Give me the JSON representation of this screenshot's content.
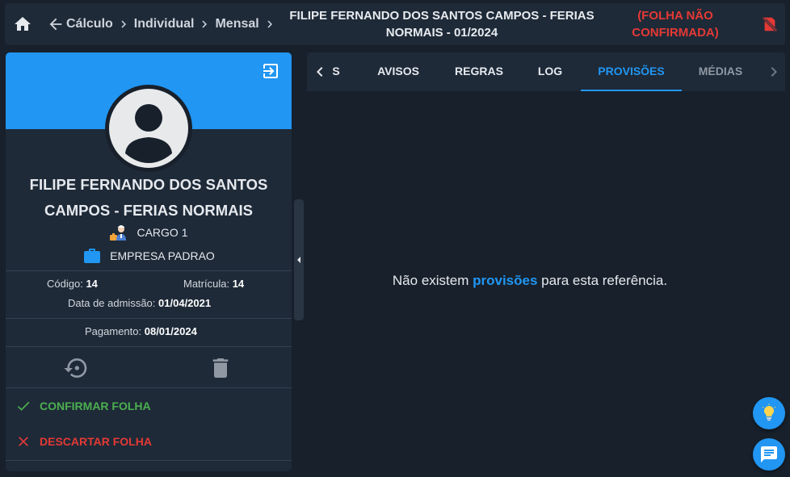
{
  "header": {
    "breadcrumbs": [
      "Cálculo",
      "Individual",
      "Mensal"
    ],
    "title_line1": "FILIPE FERNANDO DOS SANTOS CAMPOS - FERIAS",
    "title_line2": "NORMAIS - 01/2024",
    "status_line1": "(FOLHA NÃO",
    "status_line2": "CONFIRMADA)",
    "status_color": "#e53935"
  },
  "employee": {
    "name_line1": "FILIPE FERNANDO DOS SANTOS",
    "name_line2": "CAMPOS - FERIAS NORMAIS",
    "cargo": "CARGO 1",
    "empresa": "EMPRESA PADRAO",
    "codigo_label": "Código:",
    "codigo": "14",
    "matricula_label": "Matrícula:",
    "matricula": "14",
    "admissao_label": "Data de admissão:",
    "admissao": "01/04/2021",
    "pagamento_label": "Pagamento:",
    "pagamento": "08/01/2024"
  },
  "actions": {
    "confirm_label": "CONFIRMAR FOLHA",
    "confirm_color": "#4caf50",
    "discard_label": "DESCARTAR FOLHA",
    "discard_color": "#e53935"
  },
  "tabs": {
    "items": [
      "S",
      "AVISOS",
      "REGRAS",
      "LOG",
      "PROVISÕES",
      "MÉDIAS"
    ],
    "active": "PROVISÕES"
  },
  "content": {
    "empty_pre": "Não existem",
    "empty_highlight": "provisões",
    "empty_post": "para esta referência."
  },
  "colors": {
    "accent": "#2196f3",
    "background": "#17202b",
    "panel": "#1e2a38"
  },
  "icons": [
    "home-icon",
    "arrow-back-icon",
    "chevron-right-icon",
    "doc-off-icon",
    "exit-icon",
    "user-icon",
    "worker-icon",
    "briefcase-icon",
    "history-icon",
    "trash-icon",
    "check-icon",
    "close-icon",
    "lightbulb-icon",
    "chat-icon"
  ]
}
